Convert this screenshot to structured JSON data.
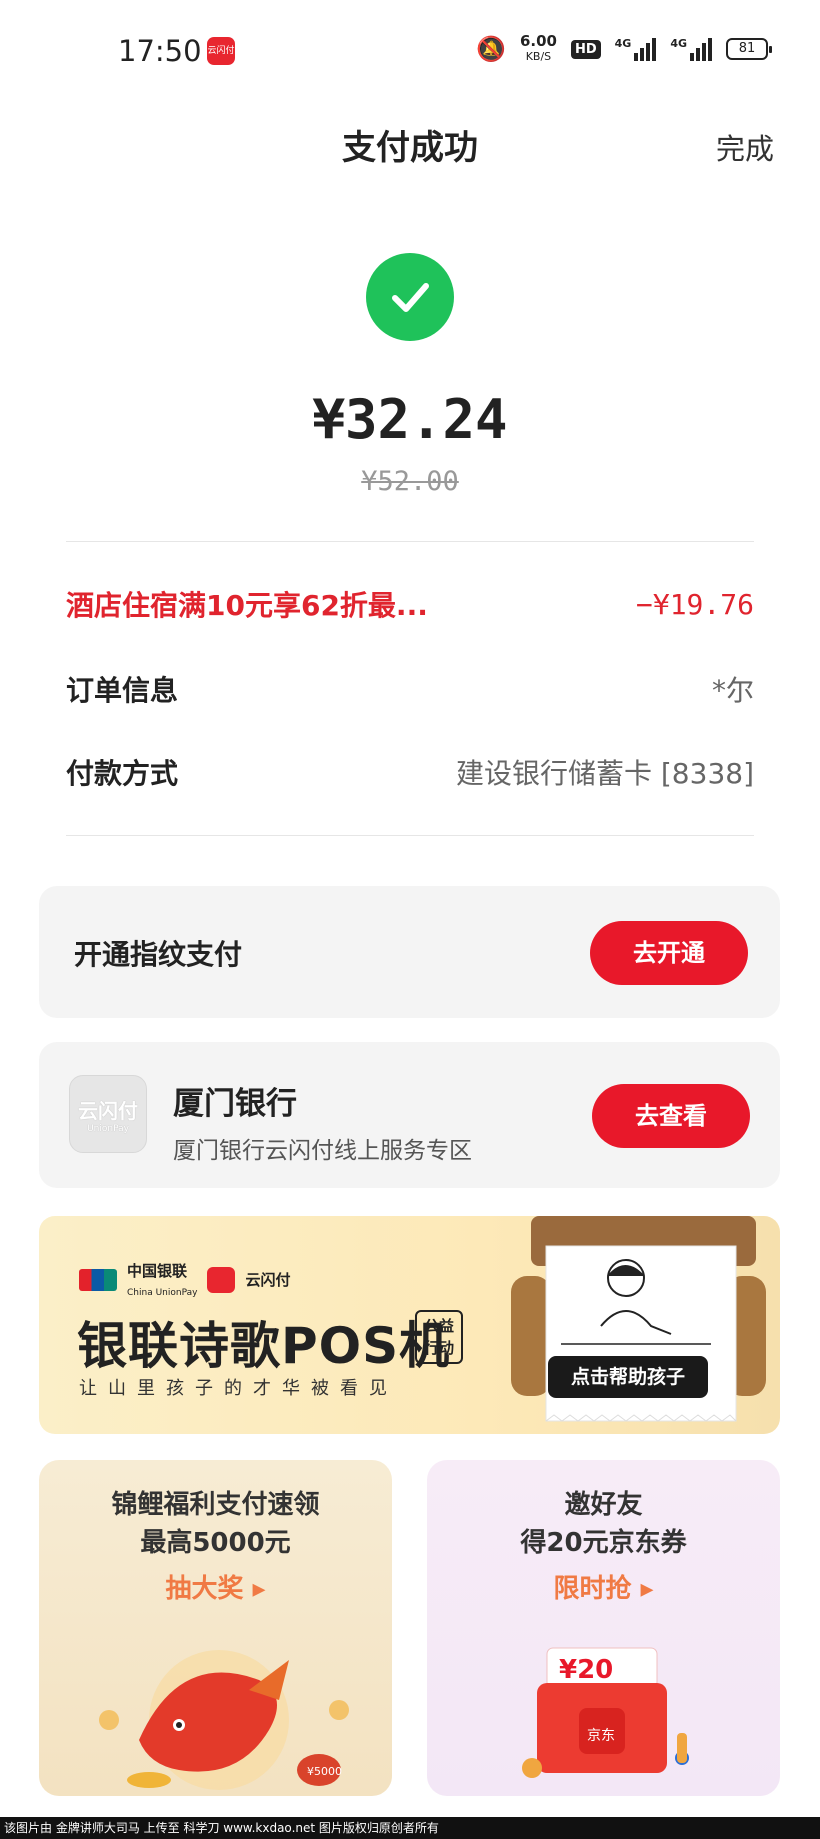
{
  "status_bar": {
    "time": "17:50",
    "app_badge": "云闪付",
    "net_speed": "6.00",
    "net_unit": "KB/S",
    "hd": "HD",
    "sig1": "4G",
    "sig2": "4G",
    "battery": "81"
  },
  "header": {
    "title": "支付成功",
    "done_label": "完成"
  },
  "payment": {
    "amount": "¥32.24",
    "original_amount": "¥52.00"
  },
  "details": {
    "promo_label": "酒店住宿满10元享62折最...",
    "promo_value": "−¥19.76",
    "order_label": "订单信息",
    "order_value": "*尔",
    "method_label": "付款方式",
    "method_value": "建设银行储蓄卡 [8338]"
  },
  "fingerprint_card": {
    "title": "开通指纹支付",
    "button": "去开通"
  },
  "bank_card": {
    "logo_text": "云闪付",
    "logo_sub": "UnionPay",
    "title": "厦门银行",
    "subtitle": "厦门银行云闪付线上服务专区",
    "button": "去查看"
  },
  "banner": {
    "unionpay_text": "中国银联",
    "unionpay_en": "China UnionPay",
    "yunshanfu_text": "云闪付",
    "title": "银联诗歌POS机",
    "tag": "公益行动",
    "subtitle": "让山里孩子的才华被看见",
    "button": "点击帮助孩子"
  },
  "promo_left": {
    "line1": "锦鲤福利支付速领",
    "line2": "最高5000元",
    "cta": "抽大奖 ▸",
    "badge": "¥5000"
  },
  "promo_right": {
    "line1": "邀好友",
    "line2": "得20元京东券",
    "cta": "限时抢 ▸",
    "coupon": "¥20",
    "brand": "京东"
  },
  "footer": {
    "text": "该图片由 金牌讲师大司马 上传至 科学刀 www.kxdao.net 图片版权归原创者所有"
  },
  "colors": {
    "accent_red": "#e8182a",
    "success_green": "#1fc25a",
    "promo_orange": "#f07a44"
  }
}
